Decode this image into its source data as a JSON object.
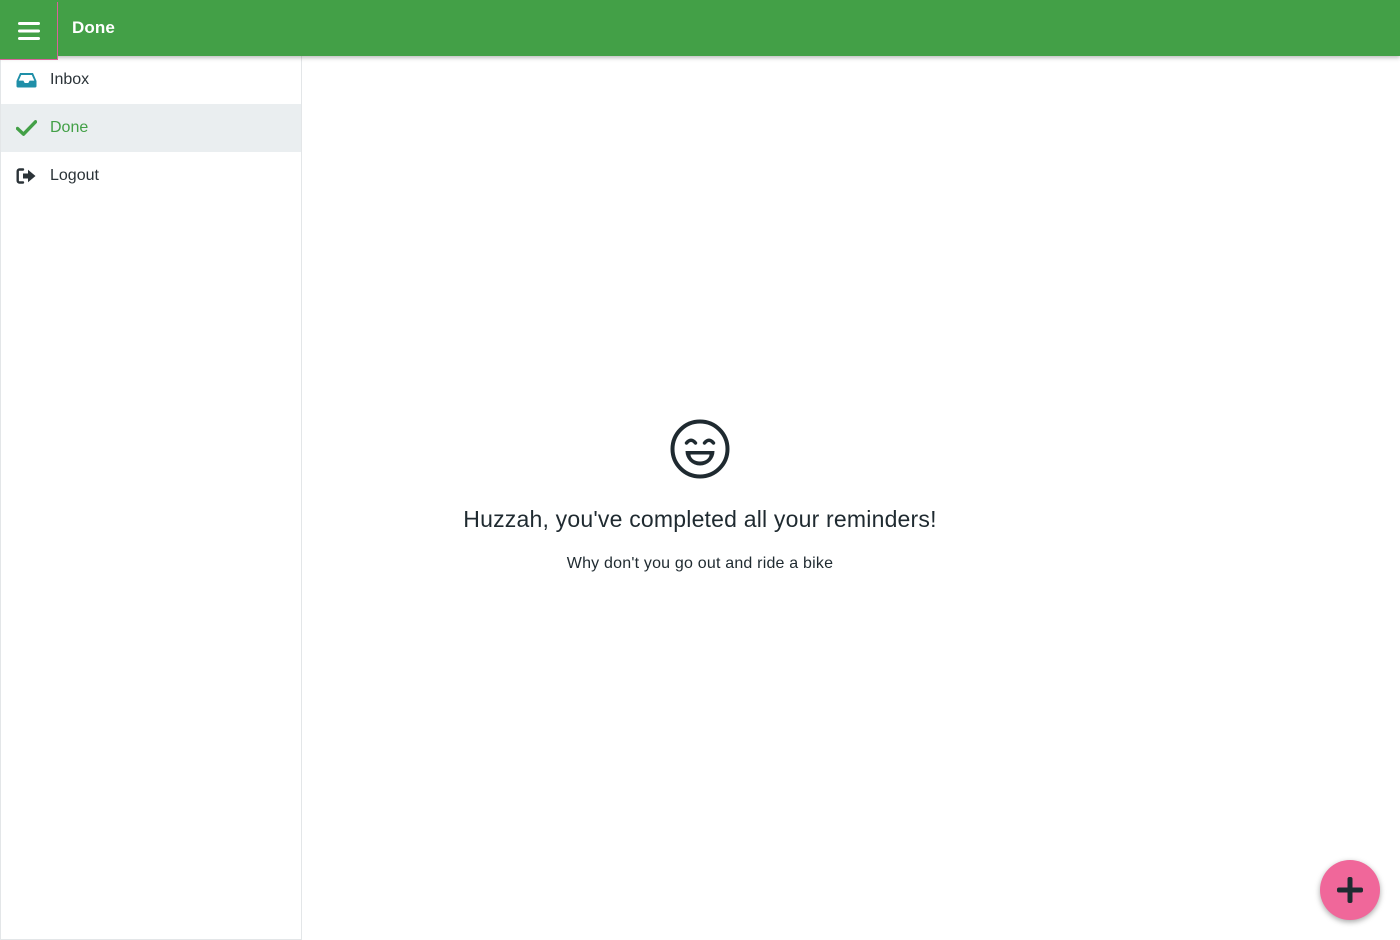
{
  "app": {
    "title": "Done",
    "colors": {
      "primary": "#43a047",
      "accent": "#f0679a",
      "inbox_icon": "#1f8fa8"
    }
  },
  "header": {
    "menu_icon": "hamburger-menu-icon",
    "title": "Done"
  },
  "sidebar": {
    "items": [
      {
        "label": "Inbox",
        "icon": "inbox-tray-icon",
        "active": false
      },
      {
        "label": "Done",
        "icon": "checkmark-icon",
        "active": true
      },
      {
        "label": "Logout",
        "icon": "logout-icon",
        "active": false
      }
    ]
  },
  "main": {
    "empty_state": {
      "icon": "smiling-face-icon",
      "title": "Huzzah, you've completed all your reminders!",
      "subtitle": "Why don't you go out and ride a bike"
    }
  },
  "fab": {
    "icon": "plus-icon"
  }
}
